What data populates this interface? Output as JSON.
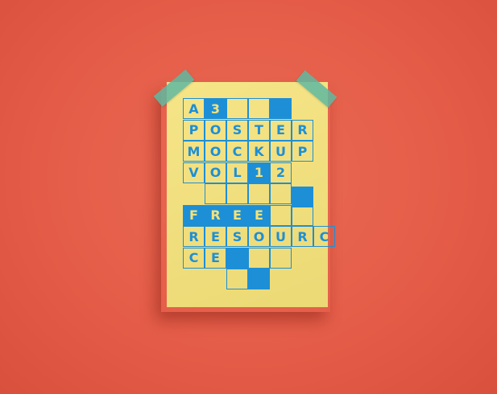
{
  "poster": {
    "background_color": "#f5e27a",
    "grid_color": "#1d8fd6",
    "wall_color": "#e45c47",
    "tape_color": "#5fb9a0",
    "rows": [
      {
        "cells": [
          {
            "t": "A"
          },
          {
            "t": "3",
            "fill": true
          },
          {
            "t": ""
          },
          {
            "t": ""
          },
          {
            "t": "",
            "fill": true
          }
        ]
      },
      {
        "cells": [
          {
            "t": "P"
          },
          {
            "t": "O"
          },
          {
            "t": "S"
          },
          {
            "t": "T"
          },
          {
            "t": "E"
          },
          {
            "t": "R"
          }
        ]
      },
      {
        "cells": [
          {
            "t": "M"
          },
          {
            "t": "O"
          },
          {
            "t": "C"
          },
          {
            "t": "K"
          },
          {
            "t": "U"
          },
          {
            "t": "P"
          }
        ]
      },
      {
        "cells": [
          {
            "t": "V"
          },
          {
            "t": "O"
          },
          {
            "t": "L"
          },
          {
            "t": "1",
            "fill": true
          },
          {
            "t": "2"
          }
        ]
      },
      {
        "cells": [
          {
            "t": ""
          },
          {
            "t": ""
          },
          {
            "t": ""
          },
          {
            "t": ""
          },
          {
            "t": "",
            "fill": true
          },
          {
            "skip": true
          }
        ],
        "offset": 1
      },
      {
        "cells": [
          {
            "t": "F",
            "fill": true
          },
          {
            "t": "R",
            "fill": true
          },
          {
            "t": "E",
            "fill": true
          },
          {
            "t": "E",
            "fill": true
          },
          {
            "t": ""
          },
          {
            "t": ""
          }
        ]
      },
      {
        "cells": [
          {
            "t": "R"
          },
          {
            "t": "E"
          },
          {
            "t": "S"
          },
          {
            "t": "O"
          },
          {
            "t": "U"
          },
          {
            "t": "R"
          },
          {
            "t": "C"
          }
        ]
      },
      {
        "cells": [
          {
            "t": "C"
          },
          {
            "t": "E"
          },
          {
            "t": "",
            "fill": true
          },
          {
            "t": ""
          },
          {
            "t": ""
          }
        ]
      },
      {
        "cells": [
          {
            "t": ""
          },
          {
            "t": "",
            "fill": true
          }
        ],
        "offset": 2
      }
    ]
  }
}
